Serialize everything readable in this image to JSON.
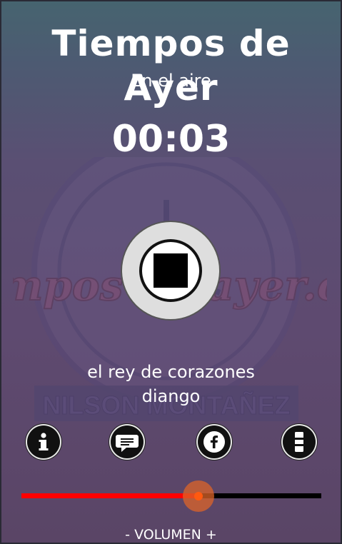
{
  "station": {
    "title": "Tiempos de Ayer",
    "status": "En el aire",
    "elapsed_time": "00:03"
  },
  "now_playing": {
    "song": "el rey de corazones",
    "artist": "diango"
  },
  "background_logo": {
    "brand_text": "Tiempos de ayer.com",
    "owner_text": "NILSON MONTAÑEZ"
  },
  "player": {
    "state": "playing",
    "control_icon": "stop-icon"
  },
  "actions": [
    {
      "name": "info-button",
      "icon": "info-icon"
    },
    {
      "name": "chat-button",
      "icon": "chat-bubble-icon"
    },
    {
      "name": "facebook-button",
      "icon": "facebook-icon"
    },
    {
      "name": "menu-button",
      "icon": "vertical-menu-icon"
    }
  ],
  "volume": {
    "label": "- VOLUMEN +",
    "level": 0.59
  },
  "colors": {
    "volume_fill": "#ff0000",
    "volume_track": "#000000",
    "volume_thumb": "#ff5a10"
  }
}
